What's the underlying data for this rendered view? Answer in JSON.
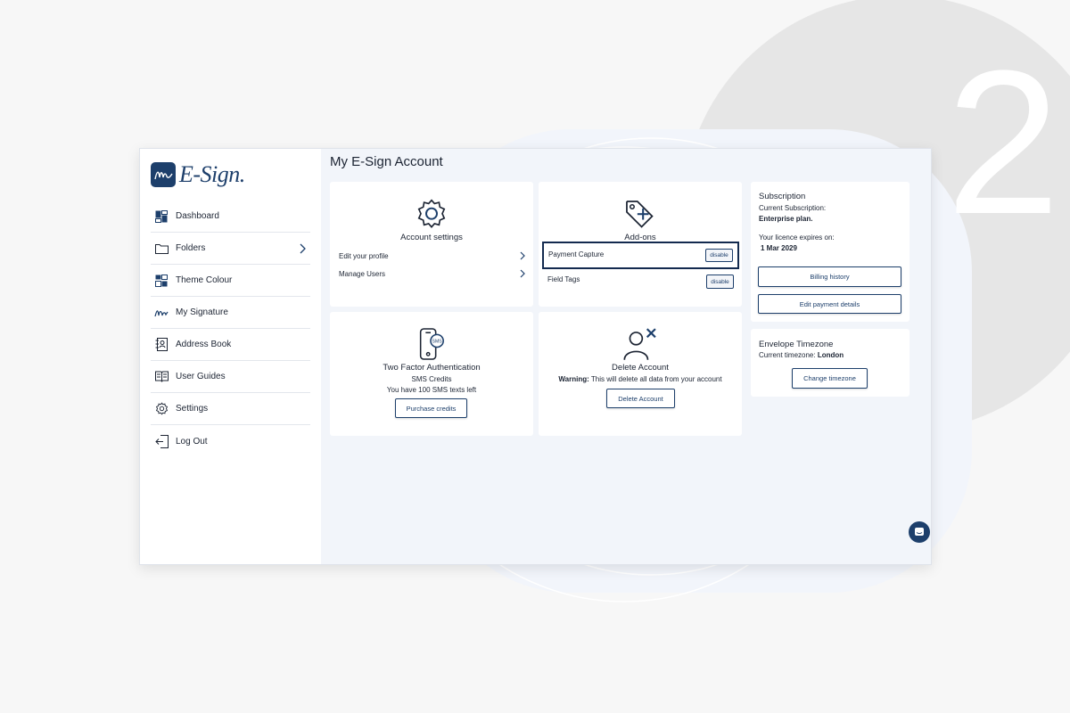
{
  "background": {
    "step_number": "2",
    "colors": {
      "page": "#f7f7f7",
      "circle": "#e6e6e6",
      "accent": "#1d3f6b"
    }
  },
  "app": {
    "logo": {
      "text": "E-Sign."
    },
    "sidebar": {
      "items": [
        {
          "label": "Dashboard",
          "icon": "dashboard-icon"
        },
        {
          "label": "Folders",
          "icon": "folder-icon",
          "has_chevron": true
        },
        {
          "label": "Theme Colour",
          "icon": "theme-icon"
        },
        {
          "label": "My Signature",
          "icon": "signature-icon"
        },
        {
          "label": "Address Book",
          "icon": "address-book-icon"
        },
        {
          "label": "User Guides",
          "icon": "user-guides-icon"
        },
        {
          "label": "Settings",
          "icon": "gear-icon"
        },
        {
          "label": "Log Out",
          "icon": "logout-icon"
        }
      ]
    },
    "main": {
      "title": "My E-Sign Account",
      "account_settings": {
        "title": "Account settings",
        "links": [
          "Edit your profile",
          "Manage Users"
        ]
      },
      "addons": {
        "title": "Add-ons",
        "items": [
          {
            "label": "Payment Capture",
            "button": "disable",
            "highlighted": true
          },
          {
            "label": "Field Tags",
            "button": "disable",
            "highlighted": false
          }
        ]
      },
      "two_factor": {
        "title": "Two Factor Authentication",
        "subtitle": "SMS Credits",
        "credits_text": "You have 100 SMS texts left",
        "button": "Purchase credits"
      },
      "delete_account": {
        "title": "Delete Account",
        "warning_label": "Warning:",
        "warning_text": "This will delete all data from your account",
        "button": "Delete Account"
      },
      "subscription": {
        "title": "Subscription",
        "current_label": "Current Subscription:",
        "plan": "Enterprise plan.",
        "expires_label": "Your licence expires on:",
        "expires_date": "1 Mar 2029",
        "billing_button": "Billing history",
        "payment_button": "Edit payment details"
      },
      "timezone": {
        "title": "Envelope Timezone",
        "current_label": "Current timezone:",
        "current_value": "London",
        "button": "Change timezone"
      }
    }
  }
}
